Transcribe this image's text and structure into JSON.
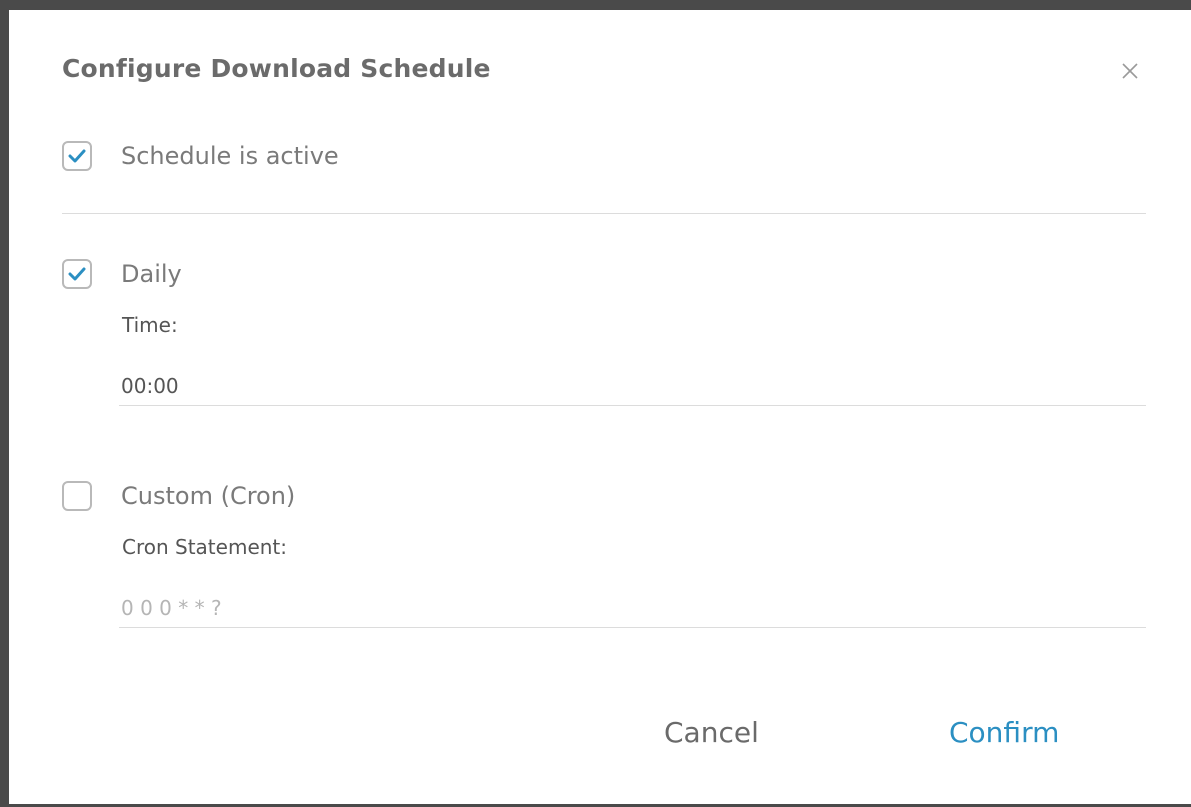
{
  "dialog": {
    "title": "Configure Download Schedule",
    "close_icon": "close-icon"
  },
  "schedule_active": {
    "label": "Schedule is active",
    "checked": true
  },
  "daily": {
    "label": "Daily",
    "checked": true,
    "time_label": "Time:",
    "time_value": "00:00"
  },
  "custom": {
    "label": "Custom (Cron)",
    "checked": false,
    "cron_label": "Cron Statement:",
    "cron_placeholder": "0 0 0 * * ?"
  },
  "buttons": {
    "cancel": "Cancel",
    "confirm": "Confirm"
  },
  "colors": {
    "accent": "#2b8fc2",
    "check": "#2b8fc2"
  }
}
